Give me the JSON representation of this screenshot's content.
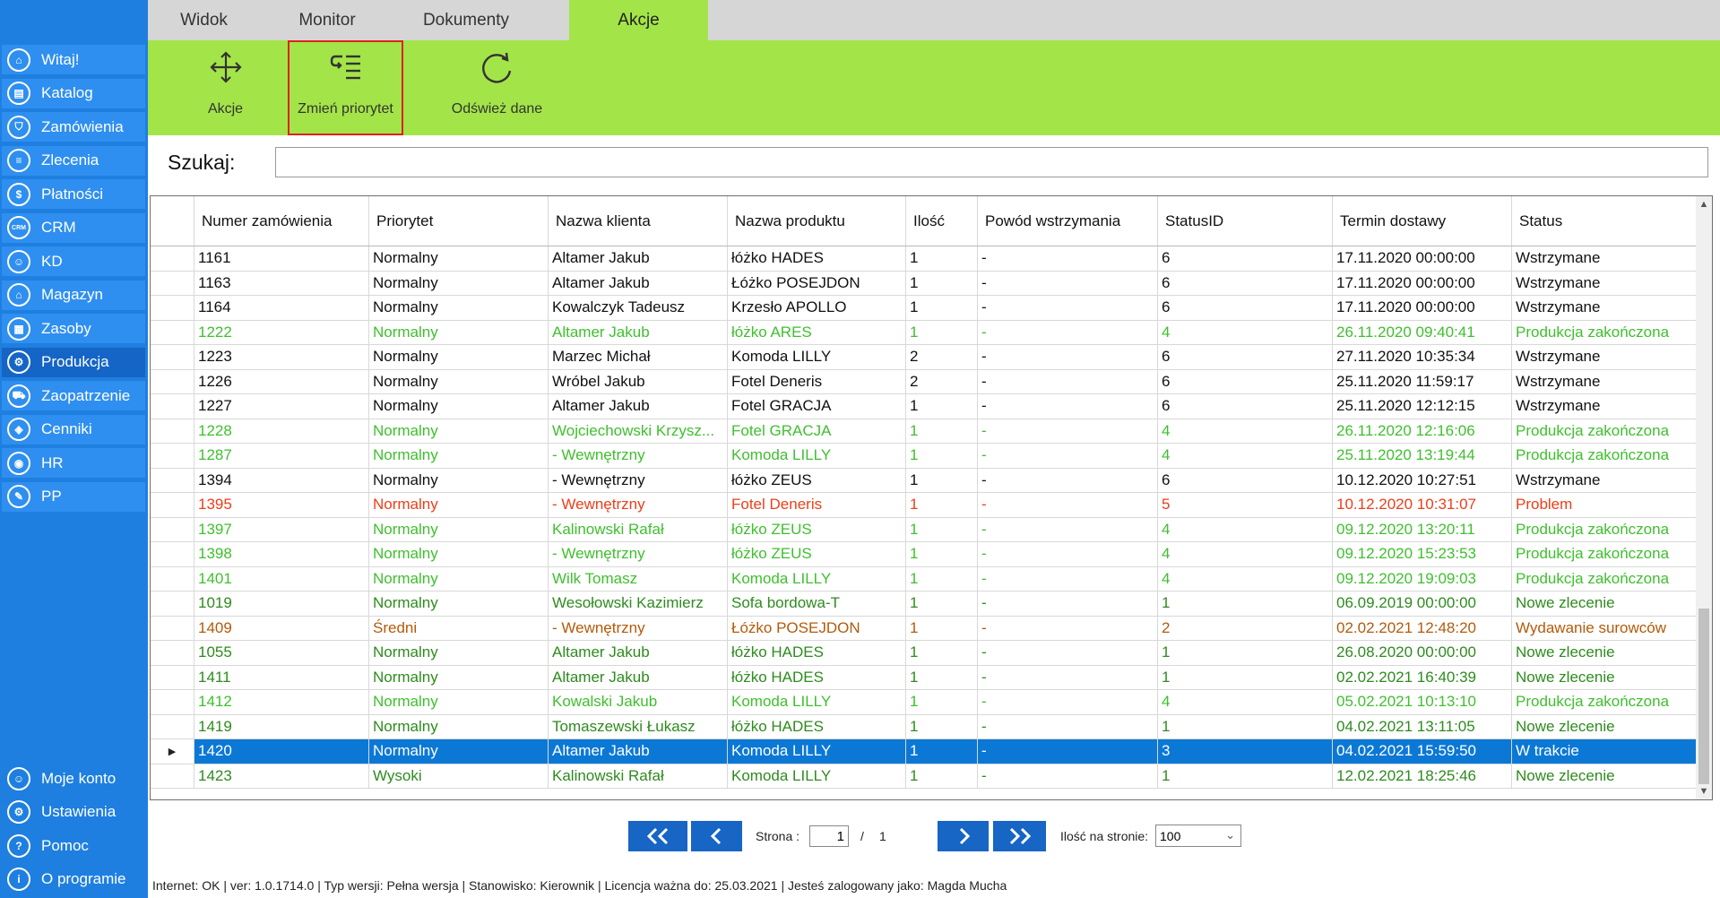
{
  "sidebar": {
    "items": [
      {
        "label": "Witaj!",
        "icon": "home-icon",
        "glyph": "⌂"
      },
      {
        "label": "Katalog",
        "icon": "book-icon",
        "glyph": "▤"
      },
      {
        "label": "Zamówienia",
        "icon": "cart-icon",
        "glyph": "⛉"
      },
      {
        "label": "Zlecenia",
        "icon": "list-icon",
        "glyph": "≡"
      },
      {
        "label": "Płatności",
        "icon": "dollar-icon",
        "glyph": "$"
      },
      {
        "label": "CRM",
        "icon": "crm-icon",
        "glyph": "CRM"
      },
      {
        "label": "KD",
        "icon": "person-icon",
        "glyph": "☺"
      },
      {
        "label": "Magazyn",
        "icon": "warehouse-icon",
        "glyph": "⌂"
      },
      {
        "label": "Zasoby",
        "icon": "resources-icon",
        "glyph": "▦"
      },
      {
        "label": "Produkcja",
        "icon": "production-icon",
        "glyph": "⚙"
      },
      {
        "label": "Zaopatrzenie",
        "icon": "supply-icon",
        "glyph": "⛟"
      },
      {
        "label": "Cenniki",
        "icon": "tag-icon",
        "glyph": "◈"
      },
      {
        "label": "HR",
        "icon": "hr-icon",
        "glyph": "◉"
      },
      {
        "label": "PP",
        "icon": "pp-icon",
        "glyph": "✎"
      }
    ],
    "bottom": [
      {
        "label": "Moje konto",
        "icon": "account-icon",
        "glyph": "☺"
      },
      {
        "label": "Ustawienia",
        "icon": "settings-icon",
        "glyph": "⚙"
      },
      {
        "label": "Pomoc",
        "icon": "help-icon",
        "glyph": "?"
      },
      {
        "label": "O programie",
        "icon": "info-icon",
        "glyph": "i"
      }
    ]
  },
  "tabs": [
    "Widok",
    "Monitor",
    "Dokumenty",
    "Akcje"
  ],
  "active_tab": "Akcje",
  "toolbar": {
    "akcje_label": "Akcje",
    "priority_label": "Zmień priorytet",
    "refresh_label": "Odśwież dane"
  },
  "search": {
    "label": "Szukaj:",
    "value": ""
  },
  "table": {
    "columns": [
      "Numer zamówienia",
      "Priorytet",
      "Nazwa klienta",
      "Nazwa produktu",
      "Ilość",
      "Powód wstrzymania",
      "StatusID",
      "Termin dostawy",
      "Status"
    ],
    "rows": [
      {
        "c": [
          "1161",
          "Normalny",
          "Altamer Jakub",
          "łóżko HADES",
          "1",
          "-",
          "6",
          "17.11.2020 00:00:00",
          "Wstrzymane"
        ],
        "color": "#111111"
      },
      {
        "c": [
          "1163",
          "Normalny",
          "Altamer Jakub",
          "Łóżko POSEJDON",
          "1",
          "-",
          "6",
          "17.11.2020 00:00:00",
          "Wstrzymane"
        ],
        "color": "#111111"
      },
      {
        "c": [
          "1164",
          "Normalny",
          "Kowalczyk Tadeusz",
          "Krzesło APOLLO",
          "1",
          "-",
          "6",
          "17.11.2020 00:00:00",
          "Wstrzymane"
        ],
        "color": "#111111"
      },
      {
        "c": [
          "1222",
          "Normalny",
          "Altamer Jakub",
          "łóżko ARES",
          "1",
          "-",
          "4",
          "26.11.2020 09:40:41",
          "Produkcja zakończona"
        ],
        "color": "#3fbf2e"
      },
      {
        "c": [
          "1223",
          "Normalny",
          "Marzec Michał",
          "Komoda LILLY",
          "2",
          "-",
          "6",
          "27.11.2020 10:35:34",
          "Wstrzymane"
        ],
        "color": "#111111"
      },
      {
        "c": [
          "1226",
          "Normalny",
          "Wróbel Jakub",
          "Fotel Deneris",
          "2",
          "-",
          "6",
          "25.11.2020 11:59:17",
          "Wstrzymane"
        ],
        "color": "#111111"
      },
      {
        "c": [
          "1227",
          "Normalny",
          "Altamer Jakub",
          "Fotel GRACJA",
          "1",
          "-",
          "6",
          "25.11.2020 12:12:15",
          "Wstrzymane"
        ],
        "color": "#111111"
      },
      {
        "c": [
          "1228",
          "Normalny",
          "Wojciechowski Krzysz...",
          "Fotel GRACJA",
          "1",
          "-",
          "4",
          "26.11.2020 12:16:06",
          "Produkcja zakończona"
        ],
        "color": "#3fbf2e"
      },
      {
        "c": [
          "1287",
          "Normalny",
          "- Wewnętrzny",
          "Komoda LILLY",
          "1",
          "-",
          "4",
          "25.11.2020 13:19:44",
          "Produkcja zakończona"
        ],
        "color": "#3fbf2e"
      },
      {
        "c": [
          "1394",
          "Normalny",
          "- Wewnętrzny",
          "łóżko ZEUS",
          "1",
          "-",
          "6",
          "10.12.2020 10:27:51",
          "Wstrzymane"
        ],
        "color": "#111111"
      },
      {
        "c": [
          "1395",
          "Normalny",
          "- Wewnętrzny",
          "Fotel Deneris",
          "1",
          "-",
          "5",
          "10.12.2020 10:31:07",
          "Problem"
        ],
        "color": "#ee3e18"
      },
      {
        "c": [
          "1397",
          "Normalny",
          "Kalinowski Rafał",
          "łóżko ZEUS",
          "1",
          "-",
          "4",
          "09.12.2020 13:20:11",
          "Produkcja zakończona"
        ],
        "color": "#3fbf2e"
      },
      {
        "c": [
          "1398",
          "Normalny",
          "- Wewnętrzny",
          "łóżko ZEUS",
          "1",
          "-",
          "4",
          "09.12.2020 15:23:53",
          "Produkcja zakończona"
        ],
        "color": "#3fbf2e"
      },
      {
        "c": [
          "1401",
          "Normalny",
          "Wilk Tomasz",
          "Komoda LILLY",
          "1",
          "-",
          "4",
          "09.12.2020 19:09:03",
          "Produkcja zakończona"
        ],
        "color": "#3fbf2e"
      },
      {
        "c": [
          "1019",
          "Normalny",
          "Wesołowski Kazimierz",
          "Sofa bordowa-T",
          "1",
          "-",
          "1",
          "06.09.2019 00:00:00",
          "Nowe zlecenie"
        ],
        "color": "#2e8b1e"
      },
      {
        "c": [
          "1409",
          "Średni",
          "- Wewnętrzny",
          "Łóżko POSEJDON",
          "1",
          "-",
          "2",
          "02.02.2021 12:48:20",
          "Wydawanie surowców"
        ],
        "color": "#b45a0a"
      },
      {
        "c": [
          "1055",
          "Normalny",
          "Altamer Jakub",
          "łóżko HADES",
          "1",
          "-",
          "1",
          "26.08.2020 00:00:00",
          "Nowe zlecenie"
        ],
        "color": "#2e8b1e"
      },
      {
        "c": [
          "1411",
          "Normalny",
          "Altamer Jakub",
          "łóżko HADES",
          "1",
          "-",
          "1",
          "02.02.2021 16:40:39",
          "Nowe zlecenie"
        ],
        "color": "#2e8b1e"
      },
      {
        "c": [
          "1412",
          "Normalny",
          "Kowalski Jakub",
          "Komoda LILLY",
          "1",
          "-",
          "4",
          "05.02.2021 10:13:10",
          "Produkcja zakończona"
        ],
        "color": "#3fbf2e"
      },
      {
        "c": [
          "1419",
          "Normalny",
          "Tomaszewski Łukasz",
          "łóżko HADES",
          "1",
          "-",
          "1",
          "04.02.2021 13:11:05",
          "Nowe zlecenie"
        ],
        "color": "#2e8b1e"
      },
      {
        "c": [
          "1420",
          "Normalny",
          "Altamer Jakub",
          "Komoda LILLY",
          "1",
          "-",
          "3",
          "04.02.2021 15:59:50",
          "W trakcie"
        ],
        "color": "#ffffff",
        "selected": true
      },
      {
        "c": [
          "1423",
          "Wysoki",
          "Kalinowski Rafał",
          "Komoda LILLY",
          "1",
          "-",
          "1",
          "12.02.2021 18:25:46",
          "Nowe zlecenie"
        ],
        "color": "#2e8b1e"
      }
    ]
  },
  "pagination": {
    "page_label": "Strona :",
    "current_page": "1",
    "separator": "/",
    "total_pages": "1",
    "per_page_label": "Ilość na stronie:",
    "per_page": "100"
  },
  "status_bar": "Internet: OK  |   ver: 1.0.1714.0   |   Typ wersji: Pełna wersja   |   Stanowisko: Kierownik   |   Licencja ważna do: 25.03.2021   |   Jesteś zalogowany jako: Magda Mucha",
  "colors": {
    "sidebar": "#1e7fe0",
    "accent": "#a3e548",
    "selected_row": "#0b78d6",
    "highlight": "#e0201e"
  }
}
